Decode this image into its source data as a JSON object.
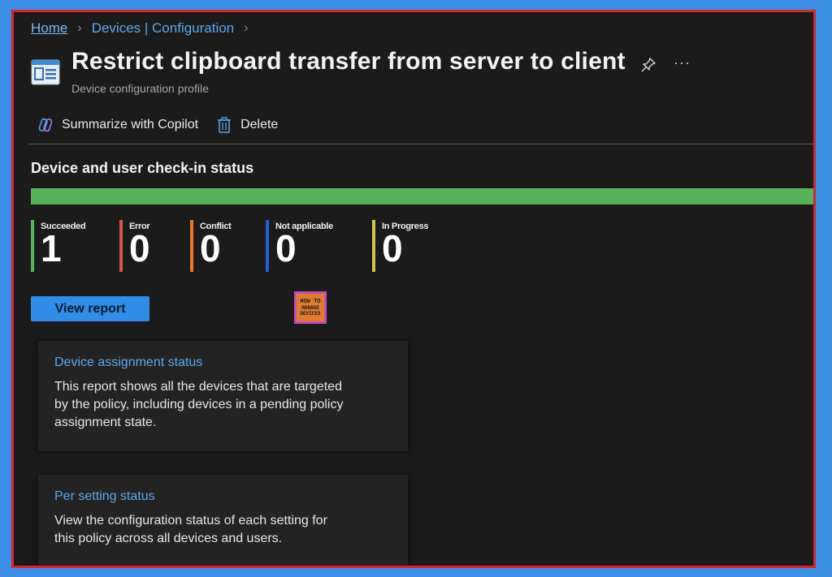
{
  "breadcrumb": {
    "home": "Home",
    "devices": "Devices | Configuration"
  },
  "header": {
    "title": "Restrict clipboard transfer from server to client",
    "subtitle": "Device configuration profile",
    "pin_icon": "pin-icon",
    "more_label": "···"
  },
  "toolbar": {
    "copilot_label": "Summarize with Copilot",
    "delete_label": "Delete"
  },
  "checkin": {
    "title": "Device and user check-in status",
    "bar_color": "#57b35a",
    "stats": [
      {
        "label": "Succeeded",
        "value": "1",
        "color": "#57b35a"
      },
      {
        "label": "Error",
        "value": "0",
        "color": "#d9534f"
      },
      {
        "label": "Conflict",
        "value": "0",
        "color": "#e8782a"
      },
      {
        "label": "Not applicable",
        "value": "0",
        "color": "#1f5fd1"
      },
      {
        "label": "In Progress",
        "value": "0",
        "color": "#d6c14a"
      }
    ],
    "view_report_label": "View report"
  },
  "logo": {
    "line1": "HOW TO",
    "line2": "MANAGE",
    "line3": "DEVICES"
  },
  "cards": [
    {
      "title": "Device assignment status",
      "description": "This report shows all the devices that are targeted by the policy, including devices in a pending policy assignment state."
    },
    {
      "title": "Per setting status",
      "description": "View the configuration status of each setting for this policy across all devices and users."
    }
  ],
  "colors": {
    "frame_border": "#d9222a",
    "background": "#1b1b1b",
    "accent": "#2e8de6"
  }
}
